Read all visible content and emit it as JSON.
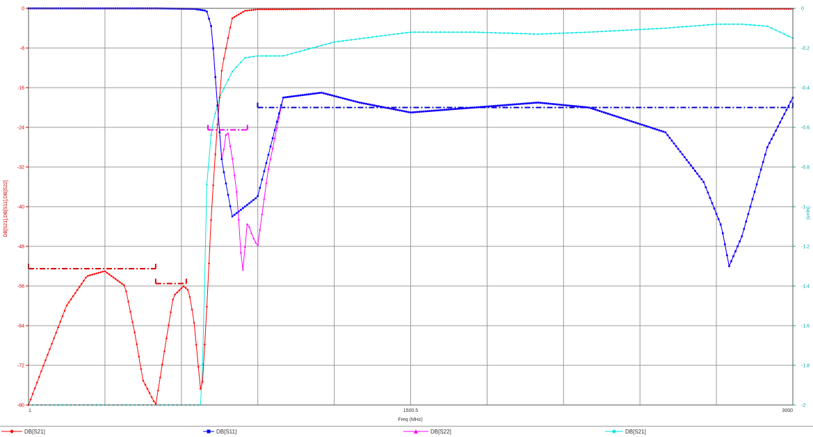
{
  "chart_data": {
    "type": "line",
    "xlabel": "Freq (MHz)",
    "ylabel": "DB[S21],DB[S11],DB[S22]",
    "ylabel_right": "(units)",
    "xlim": [
      1,
      3000
    ],
    "ylim": [
      -80,
      0
    ],
    "ylim_right": [
      -2,
      0
    ],
    "x_ticks": [
      1,
      1500.5,
      3000
    ],
    "y_ticks": [
      0,
      -8,
      -16,
      -24,
      -32,
      -40,
      -48,
      -56,
      -64,
      -72,
      -80
    ],
    "y_ticks_right": [
      0,
      -0.2,
      -0.4,
      -0.6,
      -0.8,
      -1,
      -1.2,
      -1.4,
      -1.6,
      -1.8,
      -2
    ],
    "grid": true,
    "legend_position": "bottom",
    "colors": {
      "s21": "#ff0000",
      "s11": "#0000ff",
      "s22": "#ff00ff",
      "s21_right": "#00e5e5",
      "grid": "#999999",
      "limit_red": "#dd0000",
      "limit_blue": "#0000cc",
      "limit_pink": "#ee00ee"
    },
    "series": [
      {
        "name": "DB[S21]",
        "axis": "left",
        "color": "#ff0000",
        "x": [
          1,
          60,
          150,
          230,
          300,
          380,
          420,
          450,
          500,
          560,
          570,
          610,
          630,
          650,
          680,
          700,
          720,
          740,
          760,
          800,
          850,
          900,
          1000,
          1200,
          1500,
          1800,
          2100,
          2400,
          2700,
          3000
        ],
        "y": [
          -80,
          -72,
          -60,
          -54,
          -53,
          -56,
          -66,
          -75,
          -80,
          -61,
          -58,
          -56,
          -57,
          -63,
          -79,
          -61,
          -40,
          -25,
          -12,
          -2,
          -0.5,
          -0.2,
          -0.2,
          -0.1,
          -0.1,
          -0.1,
          -0.1,
          -0.1,
          -0.1,
          -0.1
        ]
      },
      {
        "name": "DB[S11]",
        "axis": "left",
        "color": "#0000ff",
        "x": [
          1,
          200,
          500,
          650,
          700,
          720,
          740,
          760,
          800,
          900,
          1000,
          1150,
          1300,
          1500,
          1750,
          2000,
          2200,
          2500,
          2650,
          2720,
          2750,
          2800,
          2900,
          3000
        ],
        "y": [
          0,
          0,
          0,
          -0.1,
          -0.5,
          -4,
          -18,
          -31,
          -42,
          -38,
          -18,
          -17,
          -19,
          -21,
          -20,
          -19,
          -20,
          -25,
          -35,
          -44,
          -52,
          -46,
          -28,
          -18
        ]
      },
      {
        "name": "DB[S22]",
        "axis": "left",
        "color": "#ff00ff",
        "x": [
          1,
          200,
          500,
          650,
          700,
          720,
          740,
          760,
          780,
          800,
          820,
          840,
          860,
          880,
          900,
          940,
          1000,
          1150,
          1300,
          1500,
          1750,
          2000,
          2200,
          2500,
          2650,
          2720,
          2750,
          2800,
          2900,
          3000
        ],
        "y": [
          0,
          0,
          0,
          -0.1,
          -0.5,
          -4,
          -18,
          -31,
          -24,
          -30,
          -38,
          -54,
          -43,
          -46,
          -48,
          -33,
          -18,
          -17,
          -19,
          -21,
          -20,
          -19,
          -20,
          -25,
          -35,
          -44,
          -52,
          -46,
          -28,
          -18
        ]
      },
      {
        "name": "DB[S21]",
        "axis": "right",
        "color": "#00e5e5",
        "x": [
          1,
          600,
          680,
          690,
          700,
          720,
          750,
          800,
          850,
          900,
          1000,
          1200,
          1500,
          1750,
          2000,
          2200,
          2500,
          2700,
          2800,
          2900,
          3000
        ],
        "y": [
          -2,
          -2,
          -2,
          -1.5,
          -0.9,
          -0.6,
          -0.45,
          -0.32,
          -0.25,
          -0.24,
          -0.24,
          -0.17,
          -0.12,
          -0.12,
          -0.13,
          -0.12,
          -0.1,
          -0.08,
          -0.08,
          -0.09,
          -0.15
        ]
      }
    ],
    "limit_lines": [
      {
        "color": "#dd0000",
        "x": [
          1,
          500
        ],
        "y": -52.5
      },
      {
        "color": "#dd0000",
        "x": [
          500,
          620
        ],
        "y": -55.5
      },
      {
        "color": "#ee00ee",
        "x": [
          705,
          860
        ],
        "y": -24.5
      },
      {
        "color": "#0000cc",
        "x": [
          900,
          3000
        ],
        "y": -20
      }
    ]
  }
}
